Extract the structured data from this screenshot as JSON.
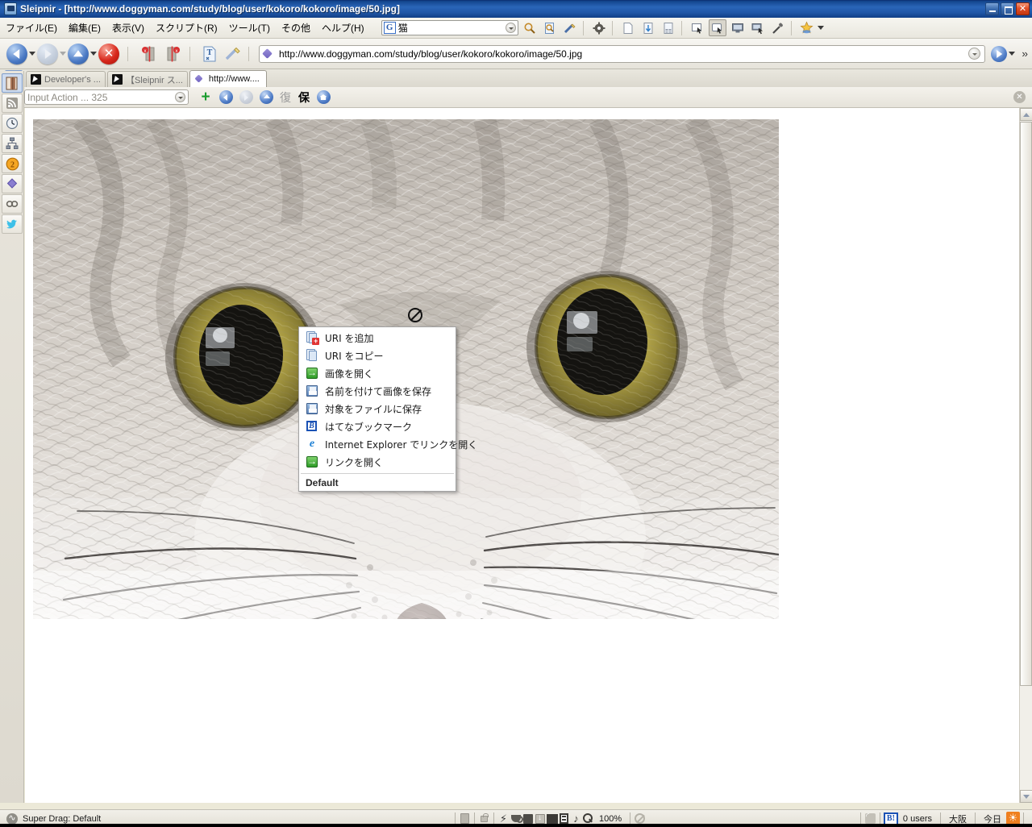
{
  "window": {
    "app_name": "Sleipnir",
    "title": "Sleipnir - [http://www.doggyman.com/study/blog/user/kokoro/kokoro/image/50.jpg]",
    "controls": {
      "minimize": "minimize-icon",
      "restore": "restore-icon",
      "close": "close-icon"
    }
  },
  "menubar": {
    "items": [
      {
        "label": "ファイル(E)",
        "name": "menu-file"
      },
      {
        "label": "編集(E)",
        "name": "menu-edit"
      },
      {
        "label": "表示(V)",
        "name": "menu-view"
      },
      {
        "label": "スクリプト(R)",
        "name": "menu-script"
      },
      {
        "label": "ツール(T)",
        "name": "menu-tools"
      },
      {
        "label": "その他",
        "name": "menu-other"
      },
      {
        "label": "ヘルプ(H)",
        "name": "menu-help"
      }
    ],
    "search": {
      "engine": "G",
      "value": "猫",
      "name": "search-input"
    },
    "icons": [
      "magnifier-icon",
      "find-page-icon",
      "paintbrush-icon",
      "gear-icon",
      "new-page-icon",
      "page-refresh-icon",
      "page-grid-icon",
      "window-select-icon",
      "window-select-active-icon",
      "monitor-icon",
      "monitor-select-icon",
      "eyedropper-icon",
      "star-favorites-icon"
    ]
  },
  "navbar": {
    "back": "back-button",
    "forward": "forward-button",
    "up": "up-button",
    "stop": "stop-button",
    "close_left": "close-tabs-left-button",
    "close_right": "close-tabs-right-button",
    "text_tool": "text-select-button",
    "edit_tool": "highlighter-button",
    "address": {
      "value": "http://www.doggyman.com/study/blog/user/kokoro/kokoro/image/50.jpg",
      "name": "address-input"
    },
    "go": "go-button",
    "overflow": "››"
  },
  "tabs": {
    "sidebar_toggle": "sidebar-toggle-button",
    "items": [
      {
        "label": "Developer's ...",
        "icon": "sleipnir-icon",
        "active": false
      },
      {
        "label": "【Sleipnir ス...",
        "icon": "sleipnir-icon",
        "active": false
      },
      {
        "label": "http://www....",
        "icon": "kite-icon",
        "active": true
      }
    ]
  },
  "actionbar": {
    "input_placeholder": "Input Action ... 325",
    "buttons": [
      {
        "name": "add-action-button",
        "glyph": "+"
      },
      {
        "name": "action-back-button",
        "glyph": "◀"
      },
      {
        "name": "action-forward-button",
        "glyph": "▶"
      },
      {
        "name": "action-up-button",
        "glyph": "▲"
      },
      {
        "name": "action-restore-button",
        "glyph": "復"
      },
      {
        "name": "action-save-button",
        "glyph": "保"
      },
      {
        "name": "action-home-button",
        "glyph": "⌂"
      }
    ],
    "close": "close-actionbar-button"
  },
  "sidebar": {
    "items": [
      {
        "name": "sidebar-bookmarks",
        "icon": "book-icon",
        "selected": true
      },
      {
        "name": "sidebar-feeds",
        "icon": "rss-icon",
        "selected": false
      },
      {
        "name": "sidebar-history",
        "icon": "clock-icon",
        "selected": false
      },
      {
        "name": "sidebar-sitemap",
        "icon": "sitemap-icon",
        "selected": false
      },
      {
        "name": "sidebar-badge",
        "icon": "badge-2-icon",
        "selected": false,
        "badge": "2"
      },
      {
        "name": "sidebar-kite",
        "icon": "kite-icon",
        "selected": false
      },
      {
        "name": "sidebar-link",
        "icon": "link-icon",
        "selected": false
      },
      {
        "name": "sidebar-twitter",
        "icon": "twitter-icon",
        "selected": false
      }
    ]
  },
  "content": {
    "image_alt": "Close-up photograph of a silver tabby cat's face",
    "cursor": "no-drop-cursor"
  },
  "context_menu": {
    "items": [
      {
        "label": "URI を追加",
        "icon": "add-uri-icon",
        "name": "ctx-add-uri"
      },
      {
        "label": "URI をコピー",
        "icon": "copy-uri-icon",
        "name": "ctx-copy-uri"
      },
      {
        "label": "画像を開く",
        "icon": "open-image-icon",
        "name": "ctx-open-image"
      },
      {
        "label": "名前を付けて画像を保存",
        "icon": "save-image-as-icon",
        "name": "ctx-save-image-as"
      },
      {
        "label": "対象をファイルに保存",
        "icon": "save-target-icon",
        "name": "ctx-save-target"
      },
      {
        "label": "はてなブックマーク",
        "icon": "hatena-bookmark-icon",
        "name": "ctx-hatena-bookmark"
      },
      {
        "label": "Internet Explorer でリンクを開く",
        "icon": "internet-explorer-icon",
        "name": "ctx-open-in-ie"
      },
      {
        "label": "リンクを開く",
        "icon": "open-link-icon",
        "name": "ctx-open-link"
      }
    ],
    "footer": "Default"
  },
  "statusbar": {
    "drag_status": "Super Drag: Default",
    "zoom": "100%",
    "hatena_badge": "B!",
    "hatena_users": "0 users",
    "region": "大阪",
    "today": "今日",
    "icons": [
      "panel-icon",
      "lock-icon",
      "lightning-icon",
      "cookie-icon",
      "block-icon",
      "download-icon",
      "flash-icon",
      "video-icon",
      "music-icon",
      "zoom-icon",
      "no-script-icon",
      "rss-status-icon",
      "weather-icon"
    ]
  },
  "colors": {
    "titlebar": "#1f56a6",
    "chrome": "#ece9d8",
    "accent_blue": "#4a79c4",
    "green": "#2e9b27",
    "red": "#d8281c",
    "orange": "#ef7f1f"
  }
}
